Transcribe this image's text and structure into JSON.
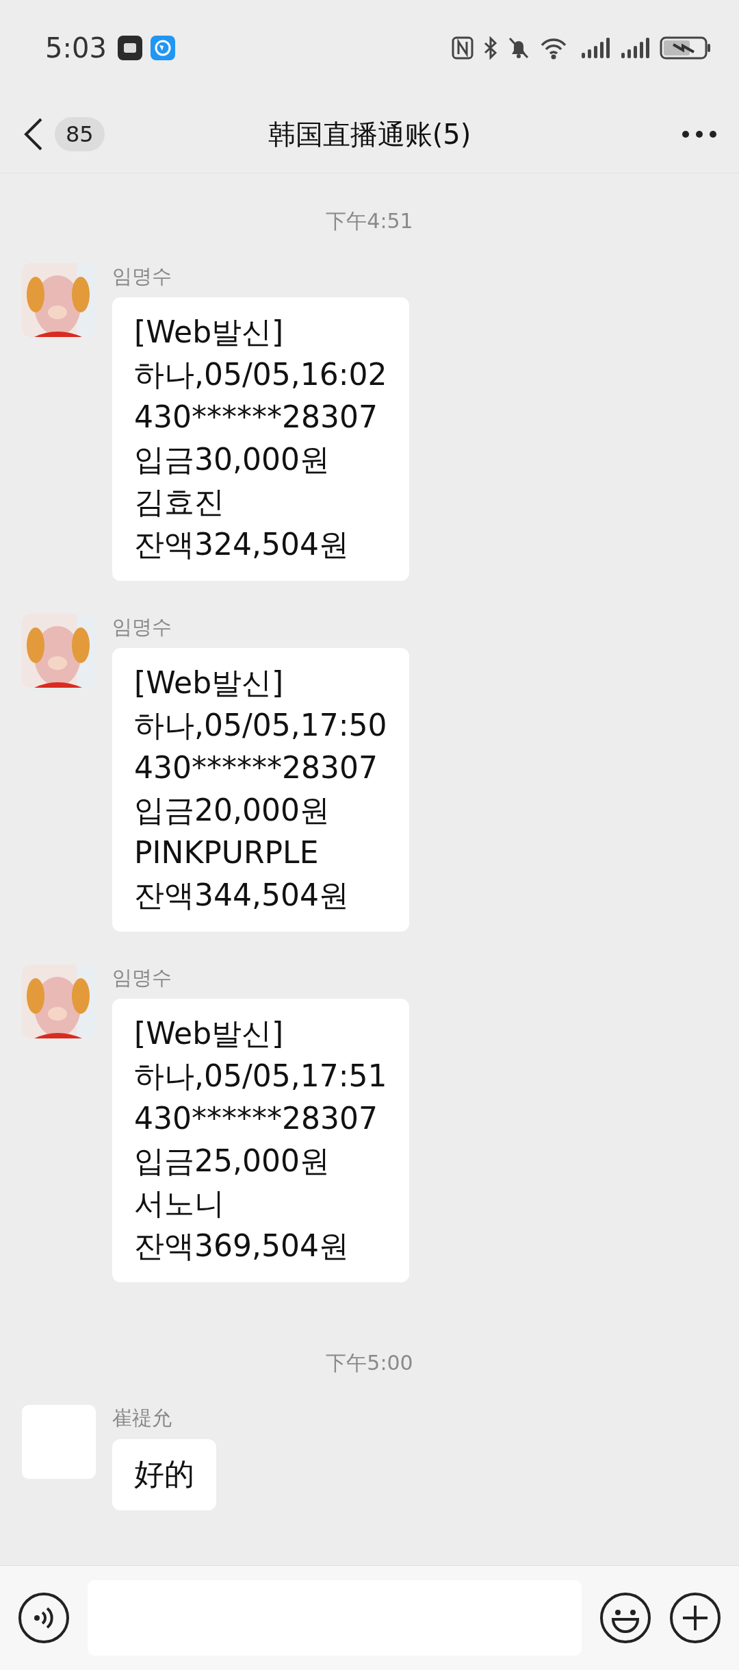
{
  "status_bar": {
    "time": "5:03"
  },
  "header": {
    "unread_count": "85",
    "title": "韩国直播通账(5)"
  },
  "messages": [
    {
      "kind": "time",
      "text": "下午4:51"
    },
    {
      "kind": "message",
      "sender": "임명수",
      "text": "[Web발신]\n하나,05/05,16:02\n430******28307\n입금30,000원\n김효진\n잔액324,504원"
    },
    {
      "kind": "message",
      "sender": "임명수",
      "text": "[Web발신]\n하나,05/05,17:50\n430******28307\n입금20,000원\nPINKPURPLE\n잔액344,504원"
    },
    {
      "kind": "message",
      "sender": "임명수",
      "text": "[Web발신]\n하나,05/05,17:51\n430******28307\n입금25,000원\n서노니\n잔액369,504원"
    },
    {
      "kind": "time",
      "text": "下午5:00"
    },
    {
      "kind": "message",
      "sender": "崔禔允",
      "avatar": {
        "kind": "blank"
      },
      "text": "好的"
    }
  ]
}
